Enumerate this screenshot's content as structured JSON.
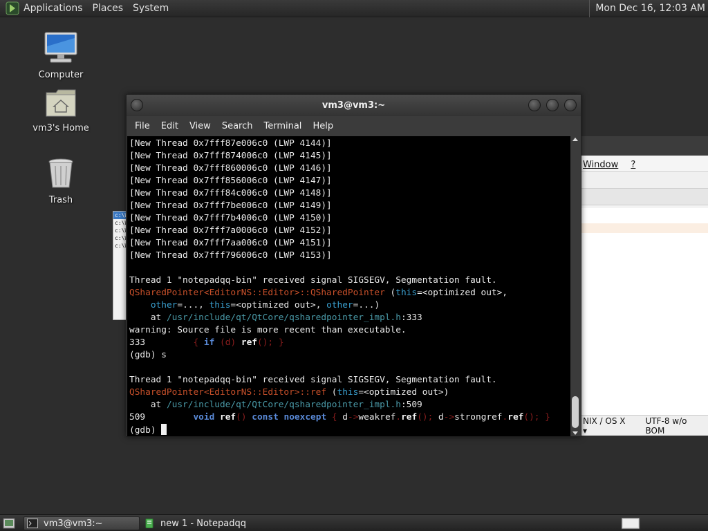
{
  "top_panel": {
    "menus": [
      "Applications",
      "Places",
      "System"
    ],
    "clock": "Mon Dec 16, 12:03 AM"
  },
  "desktop_icons": {
    "computer": "Computer",
    "home": "vm3's Home",
    "trash": "Trash"
  },
  "background_window": {
    "menu": [
      "Window",
      "?"
    ],
    "status_eol": "NIX / OS X",
    "status_encoding": "UTF-8 w/o BOM"
  },
  "small_window": {
    "rows": [
      "c:\\W",
      "c:\\W",
      "c:\\W",
      "c:\\W",
      "c:\\W"
    ]
  },
  "terminal": {
    "title": "vm3@vm3:~",
    "menu": [
      "File",
      "Edit",
      "View",
      "Search",
      "Terminal",
      "Help"
    ],
    "threads": [
      "[New Thread 0x7fff87e006c0 (LWP 4144)]",
      "[New Thread 0x7fff874006c0 (LWP 4145)]",
      "[New Thread 0x7fff860006c0 (LWP 4146)]",
      "[New Thread 0x7fff856006c0 (LWP 4147)]",
      "[New Thread 0x7fff84c006c0 (LWP 4148)]",
      "[New Thread 0x7fff7be006c0 (LWP 4149)]",
      "[New Thread 0x7fff7b4006c0 (LWP 4150)]",
      "[New Thread 0x7fff7a0006c0 (LWP 4152)]",
      "[New Thread 0x7fff7aa006c0 (LWP 4151)]",
      "[New Thread 0x7fff796006c0 (LWP 4153)]"
    ],
    "signal1": "Thread 1 \"notepadqq-bin\" received signal SIGSEGV, Segmentation fault.",
    "frame1_func": "QSharedPointer<EditorNS::Editor>::QSharedPointer",
    "frame1_args_a": " (",
    "frame1_this": "this",
    "frame1_args_b": "=<optimized out>,",
    "frame1_indent": "    ",
    "frame1_other1": "other",
    "frame1_args_c": "=..., ",
    "frame1_this2": "this",
    "frame1_args_d": "=<optimized out>, ",
    "frame1_other2": "other",
    "frame1_args_e": "=...)",
    "at_prefix": "    at ",
    "path": "/usr/include/qt/QtCore/qsharedpointer_impl.h",
    "line1_suffix": ":333",
    "warning": "warning: Source file is more recent than executable.",
    "src1_num": "333",
    "src1_gap": "         ",
    "src1_open": "{ ",
    "src1_if": "if",
    "src1_paren1": " (",
    "src1_d": "d",
    "src1_paren2": ") ",
    "src1_ref": "ref",
    "src1_close": "(); }",
    "gdb1": "(gdb) s",
    "signal2": "Thread 1 \"notepadqq-bin\" received signal SIGSEGV, Segmentation fault.",
    "frame2_func": "QSharedPointer<EditorNS::Editor>::ref",
    "frame2_args_a": " (",
    "frame2_this": "this",
    "frame2_args_b": "=<optimized out>)",
    "line2_suffix": ":509",
    "src2_num": "509",
    "src2_gap": "         ",
    "src2_void": "void",
    "src2_sp": " ",
    "src2_ref": "ref",
    "src2_p": "() ",
    "src2_const": "const",
    "src2_noexcept": "noexcept",
    "src2_brace": " { ",
    "src2_d1": "d",
    "src2_arrow1": "->",
    "src2_weak": "weakref",
    "src2_dot1": ".",
    "src2_ref2": "ref",
    "src2_semi1": "(); ",
    "src2_d2": "d",
    "src2_arrow2": "->",
    "src2_strong": "strongref",
    "src2_dot2": ".",
    "src2_ref3": "ref",
    "src2_end": "(); }",
    "prompt": "(gdb) "
  },
  "taskbar": {
    "items": [
      "vm3@vm3:~",
      "new 1 - Notepadqq"
    ]
  }
}
